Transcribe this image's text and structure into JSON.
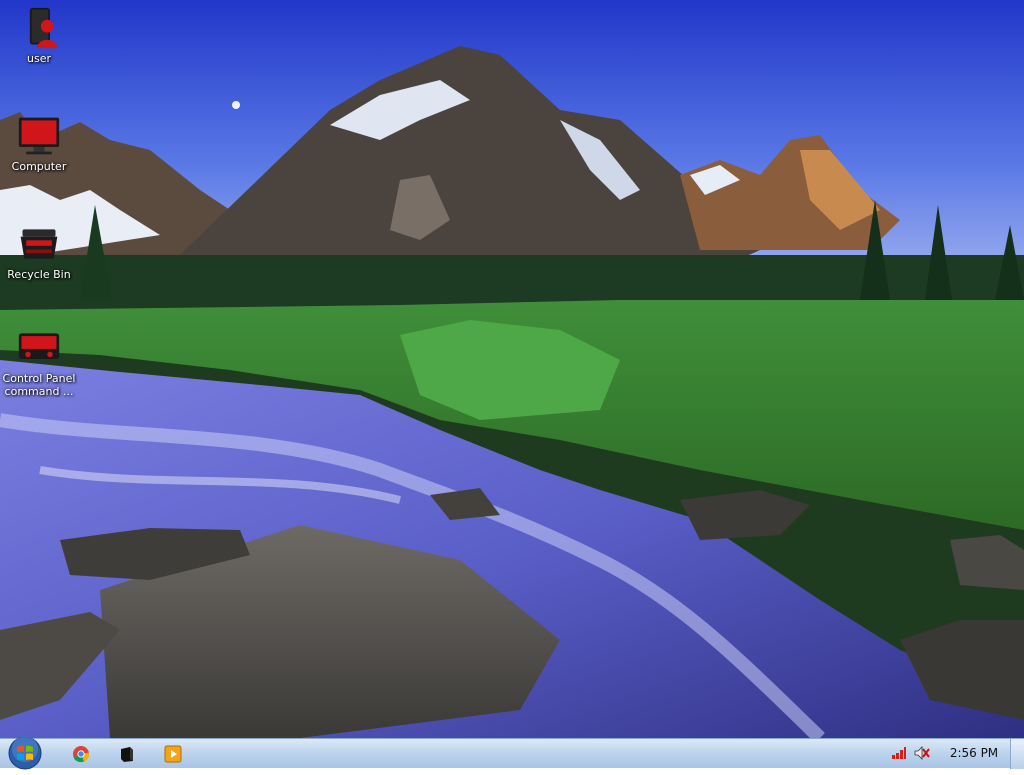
{
  "desktop": {
    "icons": [
      {
        "label": "user",
        "icon": "user-folder-icon"
      },
      {
        "label": "Computer",
        "icon": "computer-icon"
      },
      {
        "label": "Recycle Bin",
        "icon": "recycle-bin-icon"
      },
      {
        "label": "Control Panel\ncommand ...",
        "icon": "control-panel-icon"
      }
    ]
  },
  "taskbar": {
    "start_icon": "windows-logo-icon",
    "pinned": [
      {
        "icon": "chrome-icon"
      },
      {
        "icon": "terminal-icon"
      },
      {
        "icon": "media-player-icon"
      }
    ],
    "tray": {
      "icons": [
        "network-signal-icon",
        "volume-muted-icon"
      ],
      "clock": "2:56 PM"
    }
  },
  "colors": {
    "taskbar": "#bcd3ec",
    "icon_red": "#d0161b",
    "text": "#ffffff"
  }
}
